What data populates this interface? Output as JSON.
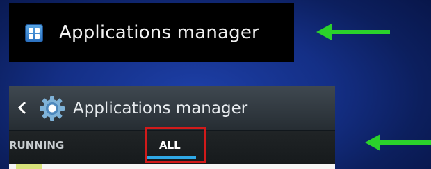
{
  "settings_item": {
    "label": "Applications manager",
    "icon": "grid-icon"
  },
  "phone": {
    "title": "Applications manager",
    "back_icon": "chevron-left-icon",
    "settings_icon": "gear-icon",
    "tabs": [
      {
        "label": "RUNNING"
      },
      {
        "label": "ALL",
        "highlighted": true
      }
    ]
  },
  "annotation_color": "#2bd22b",
  "highlight_color": "#d11a1a",
  "tab_indicator_color": "#2fa8e6"
}
